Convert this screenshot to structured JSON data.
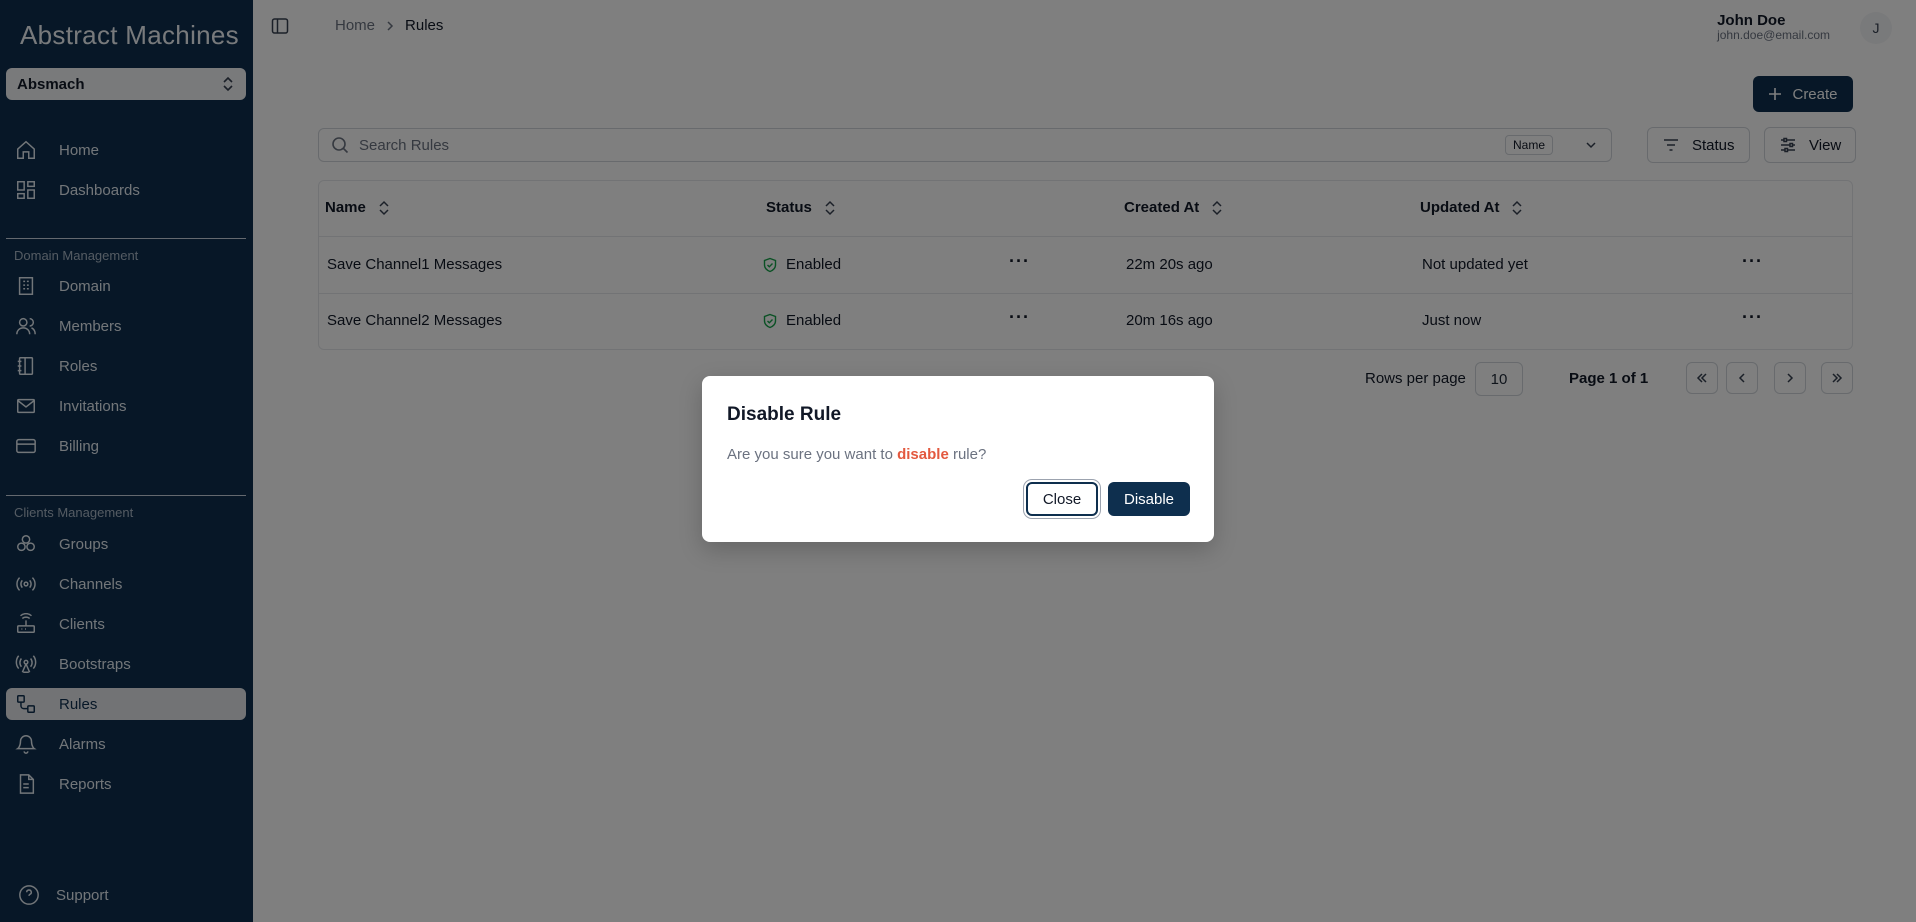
{
  "brand": {
    "logo_text": "Abstract Machines"
  },
  "workspace": {
    "name": "Absmach"
  },
  "sidebar": {
    "top_items": [
      {
        "label": "Home",
        "icon": "home-icon"
      },
      {
        "label": "Dashboards",
        "icon": "dashboard-icon"
      }
    ],
    "domain_group_label": "Domain Management",
    "domain_items": [
      {
        "label": "Domain",
        "icon": "building-icon"
      },
      {
        "label": "Members",
        "icon": "users-icon"
      },
      {
        "label": "Roles",
        "icon": "notebook-icon"
      },
      {
        "label": "Invitations",
        "icon": "mail-icon"
      },
      {
        "label": "Billing",
        "icon": "credit-card-icon"
      }
    ],
    "clients_group_label": "Clients Management",
    "clients_items": [
      {
        "label": "Groups",
        "icon": "groups-icon"
      },
      {
        "label": "Channels",
        "icon": "radio-icon"
      },
      {
        "label": "Clients",
        "icon": "router-icon"
      },
      {
        "label": "Bootstraps",
        "icon": "antenna-icon"
      },
      {
        "label": "Rules",
        "icon": "rules-icon",
        "active": true
      },
      {
        "label": "Alarms",
        "icon": "bell-icon"
      },
      {
        "label": "Reports",
        "icon": "report-icon"
      }
    ],
    "support_label": "Support"
  },
  "header": {
    "breadcrumb": [
      "Home",
      "Rules"
    ],
    "user_name": "John Doe",
    "user_email": "john.doe@email.com",
    "avatar_initial": "J"
  },
  "toolbar": {
    "create_label": "Create",
    "search_placeholder": "Search Rules",
    "search_field": "Name",
    "status_label": "Status",
    "view_label": "View"
  },
  "table": {
    "columns": [
      "Name",
      "Status",
      "Created At",
      "Updated At"
    ],
    "rows": [
      {
        "name": "Save Channel1 Messages",
        "status": "Enabled",
        "created": "22m 20s ago",
        "updated": "Not updated yet"
      },
      {
        "name": "Save Channel2 Messages",
        "status": "Enabled",
        "created": "20m 16s ago",
        "updated": "Just now"
      }
    ]
  },
  "pagination": {
    "rows_per_page_label": "Rows per page",
    "rows_per_page": "10",
    "page_info": "Page 1 of 1"
  },
  "dialog": {
    "title": "Disable Rule",
    "message_before": "Are you sure you want to ",
    "message_accent": "disable",
    "message_after": " rule?",
    "close_label": "Close",
    "confirm_label": "Disable"
  },
  "colors": {
    "sidebar_bg": "#0e2f4e",
    "primary": "#0e2f4e",
    "accent_danger": "#e3593f",
    "success": "#16a34a"
  }
}
